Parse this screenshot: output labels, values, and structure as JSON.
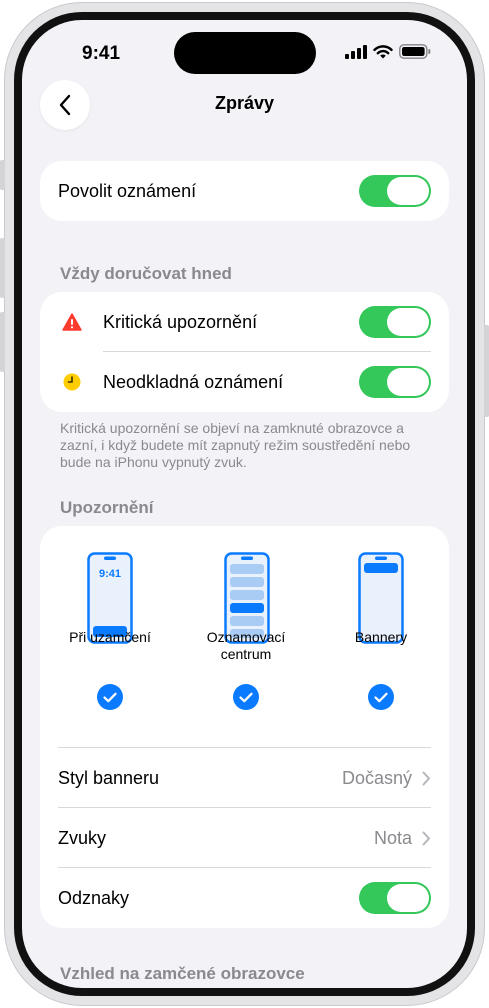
{
  "status": {
    "time": "9:41"
  },
  "nav": {
    "title": "Zprávy"
  },
  "allow": {
    "label": "Povolit oznámení",
    "on": true
  },
  "deliver": {
    "header": "Vždy doručovat hned",
    "items": [
      {
        "label": "Kritická upozornění",
        "icon": "warning-triangle-icon",
        "on": true
      },
      {
        "label": "Neodkladná oznámení",
        "icon": "clock-icon",
        "on": true
      }
    ],
    "footnote": "Kritická upozornění se objeví na zamknuté obrazovce a zazní, i když budete mít zapnutý režim soustředění nebo bude na iPhonu vypnutý zvuk."
  },
  "alerts": {
    "header": "Upozornění",
    "styles": [
      {
        "label": "Při uzamčení",
        "mini_time": "9:41",
        "checked": true
      },
      {
        "label": "Oznamovací centrum",
        "checked": true
      },
      {
        "label": "Bannery",
        "checked": true
      }
    ],
    "rows": [
      {
        "label": "Styl banneru",
        "value": "Dočasný"
      },
      {
        "label": "Zvuky",
        "value": "Nota"
      }
    ],
    "badges": {
      "label": "Odznaky",
      "on": true
    }
  },
  "lock": {
    "header": "Vzhled na zamčené obrazovce"
  },
  "colors": {
    "accent": "#0a7aff",
    "toggle_on": "#34c759",
    "warning": "#ff3b30",
    "clock": "#ffcc00"
  }
}
